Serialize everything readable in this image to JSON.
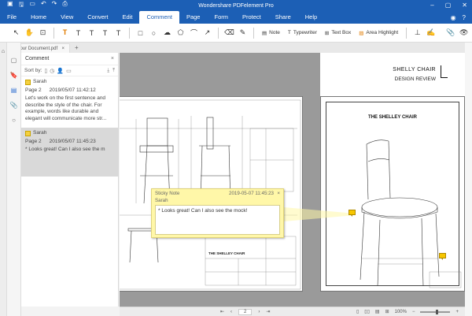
{
  "titlebar": {
    "title": "Wondershare PDFelement Pro"
  },
  "menu": {
    "items": [
      "File",
      "Home",
      "View",
      "Convert",
      "Edit",
      "Comment",
      "Page",
      "Form",
      "Protect",
      "Share",
      "Help"
    ],
    "active": "Comment"
  },
  "toolbar": {
    "note": "Note",
    "typewriter": "Typewriter",
    "textbox": "Text Box",
    "area_highlight": "Area Highlight"
  },
  "tab": {
    "name": "Your Document.pdf",
    "close": "×",
    "add": "+"
  },
  "panel": {
    "title": "Comment",
    "close": "×",
    "sort_by": "Sort by:",
    "comments": [
      {
        "author": "Sarah",
        "page": "Page 2",
        "date": "2019/05/07 11:42:12",
        "text": "Let's work on the first sentence and describe the style of the chair. For example, words like durable and elegant will communicate more str..."
      },
      {
        "author": "Sarah",
        "page": "Page 2",
        "date": "2019/05/07 11:45:23",
        "text": "* Looks great! Can I also see the m"
      }
    ]
  },
  "document": {
    "header_title": "SHELLY CHAIR",
    "header_subtitle": "DESIGN REVIEW",
    "page2_title": "THE SHELLEY CHAIR",
    "page1_block_title": "THE SHELLEY CHAIR"
  },
  "sticky": {
    "title": "Sticky Note",
    "date": "2019-05-07 11:45:23",
    "author": "Sarah",
    "text": "* Looks great! Can I also see the mock!",
    "close": "×"
  },
  "status": {
    "page": "2",
    "zoom": "100%"
  },
  "colors": {
    "accent": "#1c5fb5",
    "sticky": "#fff7a8",
    "pin": "#f7c600"
  }
}
